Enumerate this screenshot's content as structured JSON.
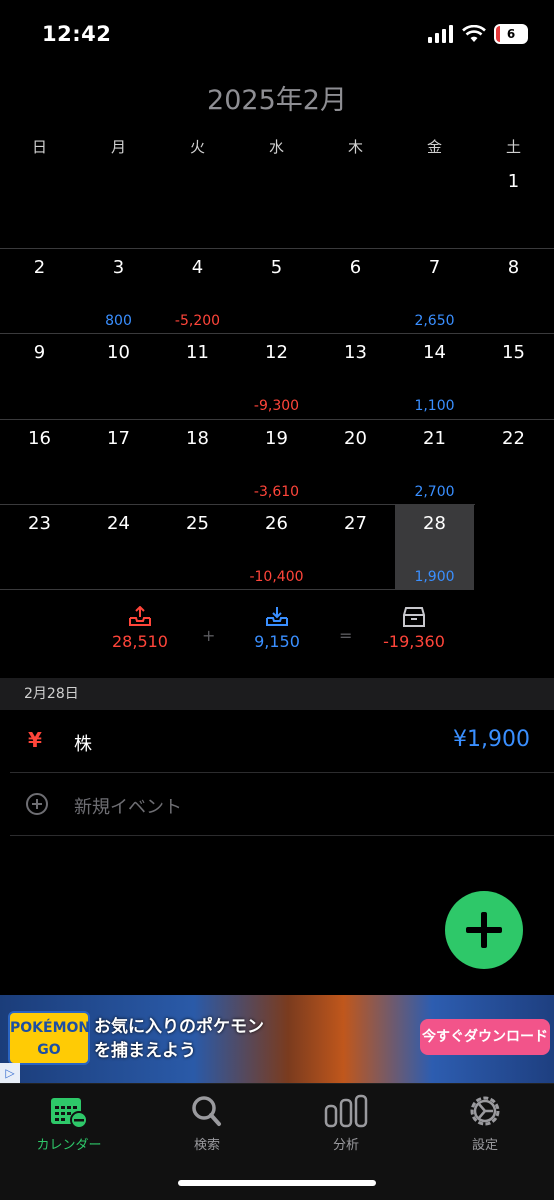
{
  "status_bar": {
    "time": "12:42",
    "battery": "6"
  },
  "header": {
    "month_title": "2025年2月"
  },
  "weekdays": [
    "日",
    "月",
    "火",
    "水",
    "木",
    "金",
    "土"
  ],
  "calendar": {
    "weeks": [
      [
        null,
        null,
        null,
        null,
        null,
        null,
        {
          "day": "1",
          "amount": ""
        }
      ],
      [
        {
          "day": "2",
          "amount": ""
        },
        {
          "day": "3",
          "amount": "800"
        },
        {
          "day": "4",
          "amount": "-5,200"
        },
        {
          "day": "5",
          "amount": ""
        },
        {
          "day": "6",
          "amount": ""
        },
        {
          "day": "7",
          "amount": "2,650"
        },
        {
          "day": "8",
          "amount": ""
        }
      ],
      [
        {
          "day": "9",
          "amount": ""
        },
        {
          "day": "10",
          "amount": ""
        },
        {
          "day": "11",
          "amount": ""
        },
        {
          "day": "12",
          "amount": "-9,300"
        },
        {
          "day": "13",
          "amount": ""
        },
        {
          "day": "14",
          "amount": "1,100"
        },
        {
          "day": "15",
          "amount": ""
        }
      ],
      [
        {
          "day": "16",
          "amount": ""
        },
        {
          "day": "17",
          "amount": ""
        },
        {
          "day": "18",
          "amount": ""
        },
        {
          "day": "19",
          "amount": "-3,610"
        },
        {
          "day": "20",
          "amount": ""
        },
        {
          "day": "21",
          "amount": "2,700"
        },
        {
          "day": "22",
          "amount": ""
        }
      ],
      [
        {
          "day": "23",
          "amount": ""
        },
        {
          "day": "24",
          "amount": ""
        },
        {
          "day": "25",
          "amount": ""
        },
        {
          "day": "26",
          "amount": "-10,400"
        },
        {
          "day": "27",
          "amount": ""
        },
        {
          "day": "28",
          "amount": "1,900",
          "selected": true
        },
        null
      ]
    ]
  },
  "summary": {
    "expense": "28,510",
    "plus_symbol": "+",
    "income": "9,150",
    "equals_symbol": "=",
    "balance": "-19,360"
  },
  "selected_date": {
    "label": "2月28日",
    "events": [
      {
        "icon": "¥",
        "name": "株",
        "amount": "¥1,900"
      }
    ],
    "new_event_label": "新規イベント"
  },
  "ad": {
    "logo_text": "POKÉMON GO",
    "headline": "お気に入りのポケモンを捕まえよう",
    "cta": "今すぐダウンロード"
  },
  "tabbar": {
    "tabs": [
      {
        "label": "カレンダー",
        "icon": "calendar-icon",
        "active": true
      },
      {
        "label": "検索",
        "icon": "search-icon",
        "active": false
      },
      {
        "label": "分析",
        "icon": "chart-icon",
        "active": false
      },
      {
        "label": "設定",
        "icon": "gear-icon",
        "active": false
      }
    ]
  },
  "colors": {
    "positive": "#3a8fff",
    "negative": "#ff453a",
    "accent": "#2ec869",
    "background": "#000000"
  }
}
